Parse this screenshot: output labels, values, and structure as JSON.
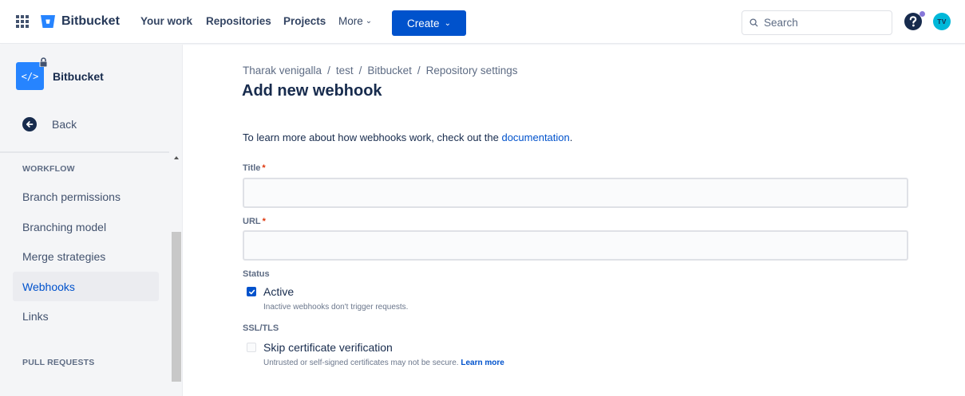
{
  "colors": {
    "brand": "#0052CC",
    "sidebar_bg": "#F4F5F7",
    "required": "#DE350B",
    "avatar_bg": "#00B8D9"
  },
  "topnav": {
    "apps_icon": "app-switcher-icon",
    "logo_text": "Bitbucket",
    "links": {
      "your_work": "Your work",
      "repositories": "Repositories",
      "projects": "Projects",
      "more": "More"
    },
    "create_label": "Create",
    "search_placeholder": "Search",
    "help_icon": "help-icon",
    "avatar_initials": "TV"
  },
  "sidebar": {
    "repo_name": "Bitbucket",
    "repo_icon_glyph": "</>",
    "back_label": "Back",
    "sections": {
      "workflow": "WORKFLOW",
      "pull_requests": "PULL REQUESTS"
    },
    "items": [
      {
        "label": "Branch permissions",
        "active": false
      },
      {
        "label": "Branching model",
        "active": false
      },
      {
        "label": "Merge strategies",
        "active": false
      },
      {
        "label": "Webhooks",
        "active": true
      },
      {
        "label": "Links",
        "active": false
      }
    ]
  },
  "main": {
    "breadcrumb": [
      "Tharak venigalla",
      "test",
      "Bitbucket",
      "Repository settings"
    ],
    "breadcrumb_separator": "/",
    "title": "Add new webhook",
    "intro_text": "To learn more about how webhooks work, check out the ",
    "intro_link": "documentation",
    "intro_end": ".",
    "form": {
      "title_label": "Title",
      "title_value": "",
      "url_label": "URL",
      "url_value": "",
      "required_mark": "*",
      "status_label": "Status",
      "active_label": "Active",
      "active_checked": true,
      "active_helper": "Inactive webhooks don't trigger requests.",
      "ssl_label": "SSL/TLS",
      "skip_label": "Skip certificate verification",
      "skip_checked": false,
      "skip_helper": "Untrusted or self-signed certificates may not be secure. ",
      "learn_more": "Learn more"
    }
  }
}
